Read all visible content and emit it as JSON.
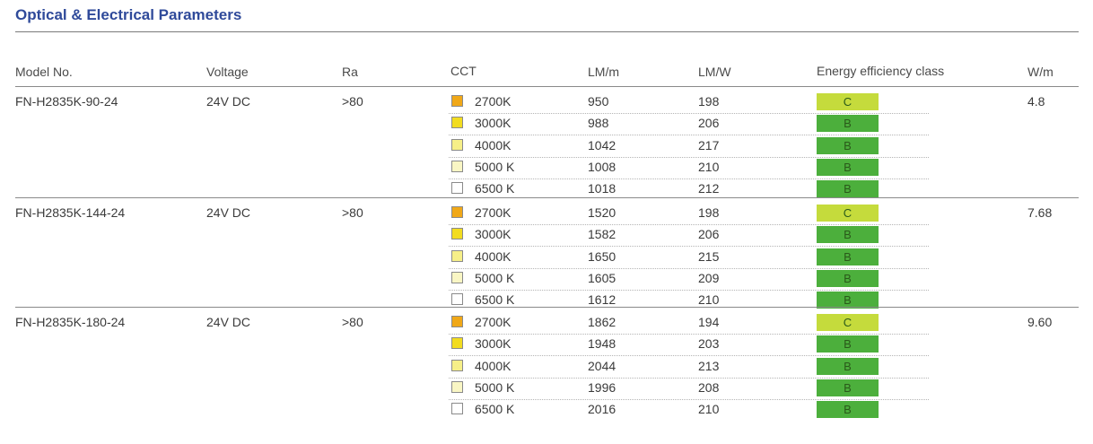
{
  "page": {
    "title": "Optical & Electrical Parameters"
  },
  "columns": {
    "model": "Model No.",
    "voltage": "Voltage",
    "ra": "Ra",
    "cct": "CCT",
    "lmm": "LM/m",
    "lmw": "LM/W",
    "energy": "Energy efficiency class",
    "wm": "W/m"
  },
  "colors": {
    "title": "#2f4a9a",
    "class_C": "#c5db3c",
    "class_B": "#4caf3c",
    "cct_2700K": "#f0a818",
    "cct_3000K": "#f2dc20",
    "cct_4000K": "#f6ef88",
    "cct_5000K": "#f9f6c4",
    "cct_6500K": "#ffffff"
  },
  "groups": [
    {
      "model": "FN-H2835K-90-24",
      "voltage": "24V DC",
      "ra": ">80",
      "wm": "4.8",
      "rows": [
        {
          "cct": "2700K",
          "swatch": "cct_2700K",
          "lmm": "950",
          "lmw": "198",
          "cls": "C"
        },
        {
          "cct": "3000K",
          "swatch": "cct_3000K",
          "lmm": "988",
          "lmw": "206",
          "cls": "B"
        },
        {
          "cct": "4000K",
          "swatch": "cct_4000K",
          "lmm": "1042",
          "lmw": "217",
          "cls": "B"
        },
        {
          "cct": "5000 K",
          "swatch": "cct_5000K",
          "lmm": "1008",
          "lmw": "210",
          "cls": "B"
        },
        {
          "cct": "6500 K",
          "swatch": "cct_6500K",
          "lmm": "1018",
          "lmw": "212",
          "cls": "B"
        }
      ]
    },
    {
      "model": "FN-H2835K-144-24",
      "voltage": "24V DC",
      "ra": ">80",
      "wm": "7.68",
      "rows": [
        {
          "cct": "2700K",
          "swatch": "cct_2700K",
          "lmm": "1520",
          "lmw": "198",
          "cls": "C"
        },
        {
          "cct": "3000K",
          "swatch": "cct_3000K",
          "lmm": "1582",
          "lmw": "206",
          "cls": "B"
        },
        {
          "cct": "4000K",
          "swatch": "cct_4000K",
          "lmm": "1650",
          "lmw": "215",
          "cls": "B"
        },
        {
          "cct": "5000 K",
          "swatch": "cct_5000K",
          "lmm": "1605",
          "lmw": "209",
          "cls": "B"
        },
        {
          "cct": "6500 K",
          "swatch": "cct_6500K",
          "lmm": "1612",
          "lmw": "210",
          "cls": "B"
        }
      ]
    },
    {
      "model": "FN-H2835K-180-24",
      "voltage": "24V DC",
      "ra": ">80",
      "wm": "9.60",
      "rows": [
        {
          "cct": "2700K",
          "swatch": "cct_2700K",
          "lmm": "1862",
          "lmw": "194",
          "cls": "C"
        },
        {
          "cct": "3000K",
          "swatch": "cct_3000K",
          "lmm": "1948",
          "lmw": "203",
          "cls": "B"
        },
        {
          "cct": "4000K",
          "swatch": "cct_4000K",
          "lmm": "2044",
          "lmw": "213",
          "cls": "B"
        },
        {
          "cct": "5000 K",
          "swatch": "cct_5000K",
          "lmm": "1996",
          "lmw": "208",
          "cls": "B"
        },
        {
          "cct": "6500 K",
          "swatch": "cct_6500K",
          "lmm": "2016",
          "lmw": "210",
          "cls": "B"
        }
      ]
    }
  ]
}
